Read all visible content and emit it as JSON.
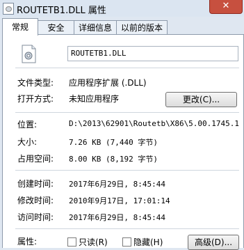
{
  "window": {
    "title": "ROUTETB1.DLL 属性",
    "close_label": "✕"
  },
  "tabs": [
    {
      "label": "常规"
    },
    {
      "label": "安全"
    },
    {
      "label": "详细信息"
    },
    {
      "label": "以前的版本"
    }
  ],
  "general": {
    "file_name": "ROUTETB1.DLL",
    "file_type_label": "文件类型:",
    "file_type_value": "应用程序扩展 (.DLL)",
    "open_with_label": "打开方式:",
    "open_with_value": "未知应用程序",
    "change_button": "更改(C)...",
    "location_label": "位置:",
    "location_value": "D:\\2013\\62901\\Routetb\\X86\\5.00.1745.1",
    "size_label": "大小:",
    "size_value": "7.26 KB (7,440 字节)",
    "size_on_disk_label": "占用空间:",
    "size_on_disk_value": "8.00 KB (8,192 字节)",
    "created_label": "创建时间:",
    "created_value": "2017年6月29日, 8:45:44",
    "modified_label": "修改时间:",
    "modified_value": "2010年9月17日, 17:01:14",
    "accessed_label": "访问时间:",
    "accessed_value": "2017年6月29日, 8:45:44",
    "attributes_label": "属性:",
    "readonly_label": "只读(R)",
    "hidden_label": "隐藏(H)",
    "advanced_button": "高级(D)..."
  }
}
